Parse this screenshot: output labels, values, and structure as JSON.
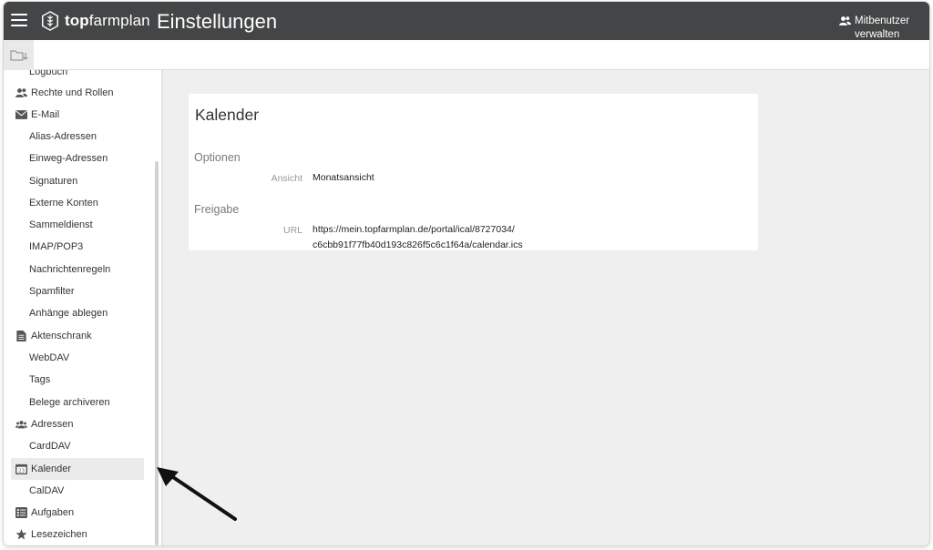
{
  "topbar": {
    "menu_icon": "hamburger-icon",
    "logo_bold": "top",
    "logo_rest": "farmplan",
    "title": "Einstellungen",
    "user_mgmt_label": "Mitbenutzer verwalten"
  },
  "subbar": {
    "folder_icon": "folder-download-icon"
  },
  "sidebar": {
    "partial_top_label": "Logbuch",
    "items": [
      {
        "label": "Rechte und Rollen",
        "icon": "users-icon",
        "level": "top"
      },
      {
        "label": "E-Mail",
        "icon": "envelope-icon",
        "level": "top"
      },
      {
        "label": "Alias-Adressen",
        "level": "sub"
      },
      {
        "label": "Einweg-Adressen",
        "level": "sub"
      },
      {
        "label": "Signaturen",
        "level": "sub"
      },
      {
        "label": "Externe Konten",
        "level": "sub"
      },
      {
        "label": "Sammeldienst",
        "level": "sub"
      },
      {
        "label": "IMAP/POP3",
        "level": "sub"
      },
      {
        "label": "Nachrichtenregeln",
        "level": "sub"
      },
      {
        "label": "Spamfilter",
        "level": "sub"
      },
      {
        "label": "Anhänge ablegen",
        "level": "sub"
      },
      {
        "label": "Aktenschrank",
        "icon": "document-icon",
        "level": "top"
      },
      {
        "label": "WebDAV",
        "level": "sub"
      },
      {
        "label": "Tags",
        "level": "sub"
      },
      {
        "label": "Belege archiveren",
        "level": "sub"
      },
      {
        "label": "Adressen",
        "icon": "contacts-icon",
        "level": "top"
      },
      {
        "label": "CardDAV",
        "level": "sub"
      },
      {
        "label": "Kalender",
        "icon": "calendar-icon",
        "level": "top",
        "active": true,
        "calendar_day": "23"
      },
      {
        "label": "CalDAV",
        "level": "sub"
      },
      {
        "label": "Aufgaben",
        "icon": "tasks-icon",
        "level": "top"
      },
      {
        "label": "Lesezeichen",
        "icon": "star-icon",
        "level": "top"
      }
    ]
  },
  "main": {
    "card_title": "Kalender",
    "sections": {
      "options_heading": "Optionen",
      "view_label": "Ansicht",
      "view_value": "Monatsansicht",
      "sharing_heading": "Freigabe",
      "url_label": "URL",
      "url_line1": "https://mein.topfarmplan.de/portal/ical/8727034/",
      "url_line2": "c6cbb91f77fb40d193c826f5c6c1f64a/calendar.ics"
    }
  },
  "annotation": {
    "icon": "arrow-pointer-icon"
  },
  "colors": {
    "topbar_bg": "#444546",
    "content_bg": "#efefef",
    "active_item_bg": "#ebebeb"
  }
}
